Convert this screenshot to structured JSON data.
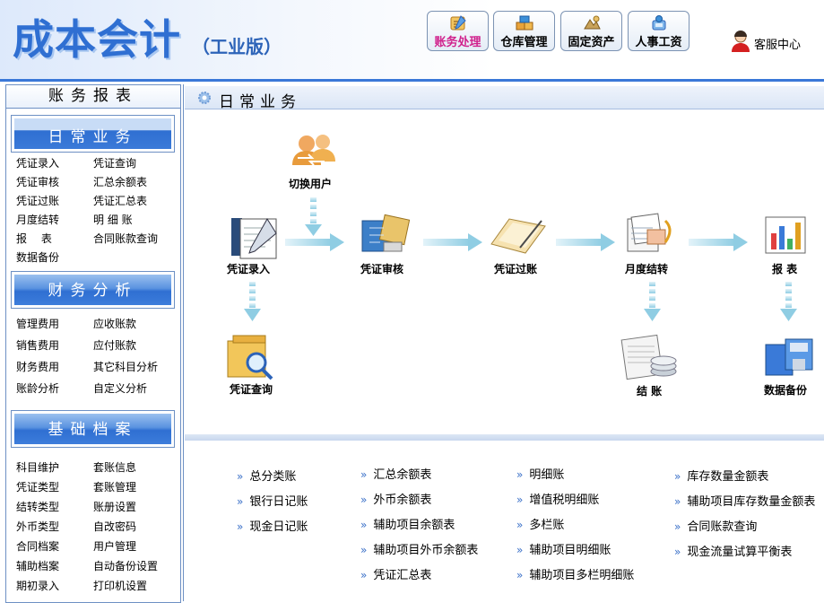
{
  "header": {
    "app_title": "成本会计",
    "app_edition": "（工业版）",
    "nav_buttons": [
      {
        "label": "账务处理",
        "icon": "ledger-icon",
        "active": true
      },
      {
        "label": "仓库管理",
        "icon": "warehouse-icon",
        "active": false
      },
      {
        "label": "固定资产",
        "icon": "assets-icon",
        "active": false
      },
      {
        "label": "人事工资",
        "icon": "hr-icon",
        "active": false
      }
    ],
    "service_label": "客服中心"
  },
  "sidebar": {
    "title": "账务报表",
    "sections": [
      {
        "title": "日常业务",
        "items": [
          "凭证录入",
          "凭证查询",
          "凭证审核",
          "汇总余额表",
          "凭证过账",
          "凭证汇总表",
          "月度结转",
          "明 细 账",
          "报　 表",
          "合同账款查询",
          "数据备份"
        ]
      },
      {
        "title": "财务分析",
        "items": [
          "管理费用",
          "应收账款",
          "销售费用",
          "应付账款",
          "财务费用",
          "其它科目分析",
          "账龄分析",
          "自定义分析"
        ]
      },
      {
        "title": "基础档案",
        "items": [
          "科目维护",
          "套账信息",
          "凭证类型",
          "套账管理",
          "结转类型",
          "账册设置",
          "外币类型",
          "自改密码",
          "合同档案",
          "用户管理",
          "辅助档案",
          "自动备份设置",
          "期初录入",
          "打印机设置"
        ]
      }
    ]
  },
  "main": {
    "title": "日常业务",
    "flow": {
      "switch_user": "切换用户",
      "steps": [
        "凭证录入",
        "凭证审核",
        "凭证过账",
        "月度结转",
        "报 表"
      ],
      "voucher_query": "凭证查询",
      "close_account": "结 账",
      "data_backup": "数据备份"
    },
    "report_links": [
      [
        "总分类账",
        "银行日记账",
        "现金日记账"
      ],
      [
        "汇总余额表",
        "外币余额表",
        "辅助项目余额表",
        "辅助项目外币余额表",
        "凭证汇总表"
      ],
      [
        "明细账",
        "增值税明细账",
        "多栏账",
        "辅助项目明细账",
        "辅助项目多栏明细账"
      ],
      [
        "库存数量金额表",
        "辅助项目库存数量金额表",
        "合同账款查询",
        "现金流量试算平衡表"
      ]
    ]
  },
  "colors": {
    "accent": "#2f6fd2",
    "active_nav": "#d0208c",
    "link_bullet": "#3a70c8",
    "arrow": "#9fd3e6"
  }
}
